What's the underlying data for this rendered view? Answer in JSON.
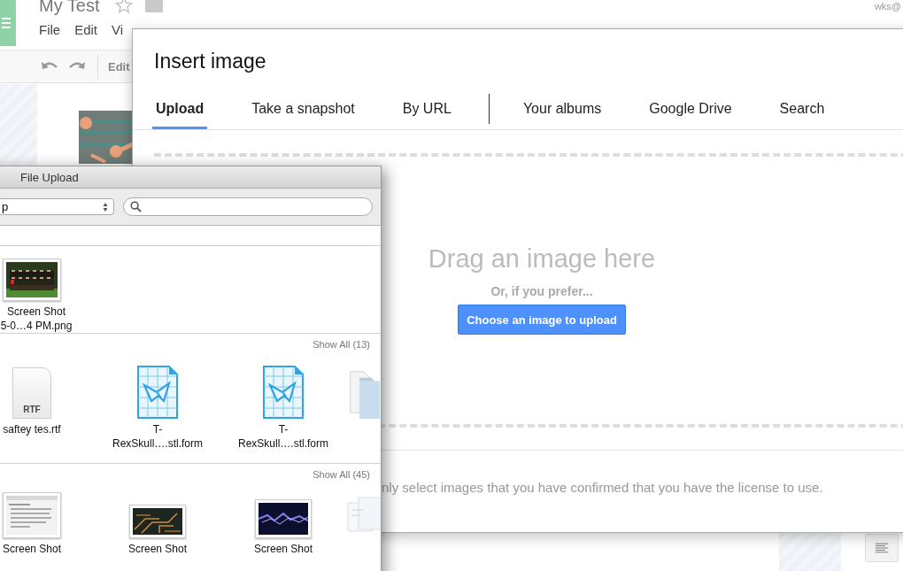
{
  "app": {
    "title": "My Test",
    "menu": [
      "File",
      "Edit",
      "Vi"
    ],
    "toolbar_label": "Edit",
    "account": "wks@"
  },
  "dialog": {
    "title": "Insert image",
    "tab_groups": [
      [
        {
          "label": "Upload",
          "selected": true
        },
        {
          "label": "Take a snapshot",
          "selected": false
        },
        {
          "label": "By URL",
          "selected": false
        }
      ],
      [
        {
          "label": "Your albums",
          "selected": false
        },
        {
          "label": "Google Drive",
          "selected": false
        },
        {
          "label": "Search",
          "selected": false
        }
      ]
    ],
    "drop_heading": "Drag an image here",
    "drop_subtext": "Or, if you prefer...",
    "choose_button": "Choose an image to upload",
    "notice": "nly select images that you have confirmed that you have the license to use."
  },
  "file_upload": {
    "title": "File Upload",
    "location": "p",
    "sections": [
      {
        "items": [
          {
            "kind": "team-photo",
            "lines": [
              "Screen Shot",
              "5-0…4 PM.png"
            ]
          }
        ]
      },
      {
        "show_all": "Show All (13)",
        "items": [
          {
            "kind": "rtf",
            "badge": "RTF",
            "lines": [
              "saftey tes.rtf"
            ]
          },
          {
            "kind": "stl-form",
            "lines": [
              "T-",
              "RexSkull….stl.form"
            ]
          },
          {
            "kind": "stl-form",
            "lines": [
              "T-",
              "RexSkull….stl.form"
            ]
          },
          {
            "kind": "doc-stack"
          }
        ]
      },
      {
        "show_all": "Show All (45)",
        "items": [
          {
            "kind": "form-screenshot",
            "lines": [
              "Screen Shot"
            ]
          },
          {
            "kind": "circuit-photo",
            "lines": [
              "Screen Shot"
            ]
          },
          {
            "kind": "lightning-photo",
            "lines": [
              "Screen Shot"
            ]
          },
          {
            "kind": "window-stack"
          }
        ]
      }
    ]
  }
}
